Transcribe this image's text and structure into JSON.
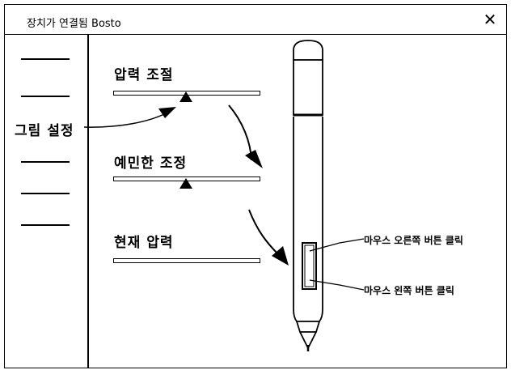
{
  "window": {
    "title": "장치가 연결됨 Bosto",
    "close_glyph": "✕"
  },
  "sidebar": {
    "item_count": 5,
    "callout_label": "그림 설정"
  },
  "settings": {
    "pressure": {
      "label": "압력 조절"
    },
    "sensitivity": {
      "label": "예민한 조정"
    },
    "current_pressure": {
      "label": "현재 압력"
    }
  },
  "pen": {
    "upper_button_label": "마우스 오른쪽 버튼 클릭",
    "lower_button_label": "마우스 왼쪽 버튼 클릭"
  }
}
